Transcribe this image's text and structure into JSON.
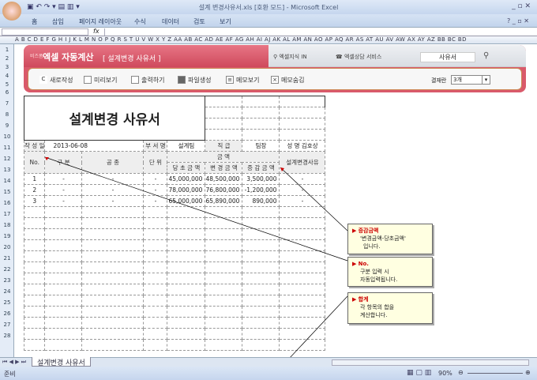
{
  "window": {
    "title": "설계 변경사유서.xls [호환 모드] - Microsoft Excel"
  },
  "ribbon": {
    "tabs": [
      "홈",
      "삽입",
      "페이지 레이아웃",
      "수식",
      "데이터",
      "검토",
      "보기"
    ]
  },
  "formula_bar": {
    "fx": "fx",
    "value": ""
  },
  "columns": "A B C D E F G H I J K L M N O P Q R S T U V W X Y Z AA AB AC AD AE AF AG AH AI AJ AK AL AM AN AO AP AQ AR AS AT AU AV AW AX AY AZ BB BC BD",
  "rows": [
    "1",
    "2",
    "3",
    "4",
    "5",
    "6",
    "7",
    "8",
    "9",
    "10",
    "11",
    "12",
    "13",
    "14",
    "15",
    "16",
    "17",
    "18",
    "19",
    "20",
    "21",
    "22",
    "23",
    "24",
    "25",
    "26",
    "27",
    "28"
  ],
  "banner": {
    "brand_small": "비즈폼",
    "brand": "엑셀 자동계산",
    "subtitle": "[ 설계변경 사유서 ]",
    "link1": "엑셀지식 IN",
    "link2": "엑셀상담 서비스",
    "search_value": "사유서",
    "buttons": [
      "새로작성",
      "미리보기",
      "출력하기",
      "파일생성",
      "메모보기",
      "메모숨김"
    ],
    "result_label": "결재란",
    "result_value": "3개"
  },
  "document": {
    "title": "설계변경 사유서",
    "info": {
      "date_label": "작 성 일",
      "date": "2013-06-08",
      "dept_label": "부 서 명",
      "dept": "설계팀",
      "rank_label": "직  급",
      "rank": "팀장",
      "name_label": "성  명",
      "name": "김호상"
    },
    "headers": {
      "no": "No.",
      "category": "구  분",
      "work": "공    종",
      "unit": "단 위",
      "amount": "금      액",
      "original": "당 초 금 액",
      "changed": "변 경 금 액",
      "diff": "증 감 금 액",
      "reason": "설계변경사유"
    },
    "rows": [
      {
        "no": "1",
        "category": "-",
        "work": "-",
        "unit": "-",
        "original": "45,000,000",
        "changed": "48,500,000",
        "diff": "3,500,000",
        "reason": "-"
      },
      {
        "no": "2",
        "category": "-",
        "work": "-",
        "unit": "-",
        "original": "78,000,000",
        "changed": "76,800,000",
        "diff": "-1,200,000",
        "reason": "-"
      },
      {
        "no": "3",
        "category": "-",
        "work": "-",
        "unit": "-",
        "original": "65,000,000",
        "changed": "65,890,000",
        "diff": "890,000",
        "reason": "-"
      }
    ]
  },
  "notes": [
    {
      "title": "증감금액",
      "line1": "'변경금액-당초금액'",
      "line2": "입니다."
    },
    {
      "title": "No.",
      "line1": "구분 입력 시",
      "line2": "자동입력됩니다."
    },
    {
      "title": "합계",
      "line1": "각 항목의 합을",
      "line2": "계산합니다."
    }
  ],
  "sheet_tab": "설계변경 사유서",
  "status": {
    "ready": "준비",
    "zoom": "90%"
  }
}
